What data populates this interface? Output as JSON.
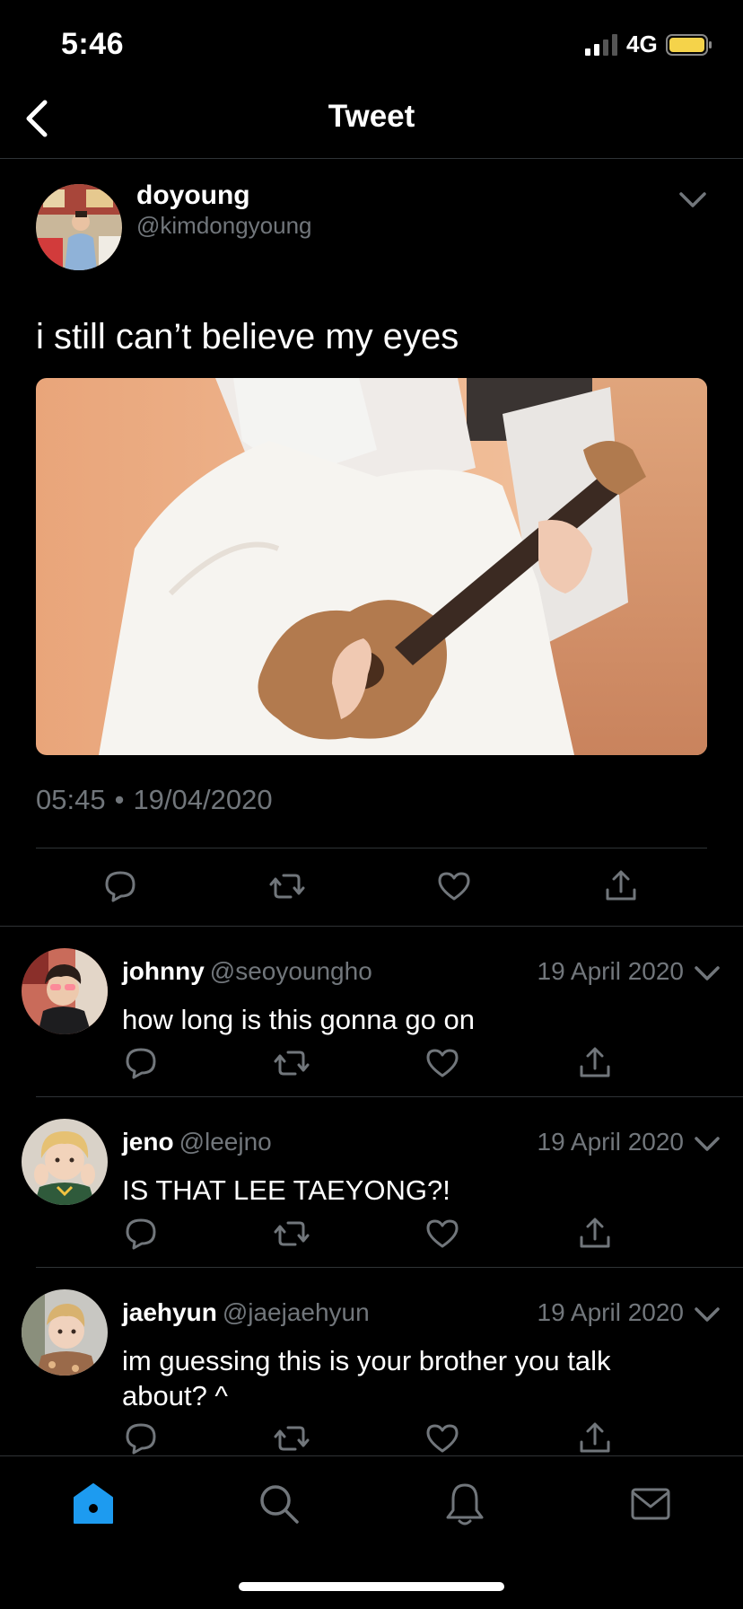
{
  "status_bar": {
    "time": "5:46",
    "network": "4G"
  },
  "header": {
    "title": "Tweet"
  },
  "main_tweet": {
    "display_name": "doyoung",
    "handle": "@kimdongyoung",
    "text": "i still can’t believe my eyes",
    "time": "05:45",
    "separator": "•",
    "date": "19/04/2020"
  },
  "replies": [
    {
      "display_name": "johnny",
      "handle": "@seoyoungho",
      "date": "19 April 2020",
      "text": "how long is this gonna go on"
    },
    {
      "display_name": "jeno",
      "handle": "@leejno",
      "date": "19 April 2020",
      "text": "IS THAT LEE TAEYONG?!"
    },
    {
      "display_name": "jaehyun",
      "handle": "@jaejaehyun",
      "date": "19 April 2020",
      "text": "im guessing this is your brother you talk about? ^"
    }
  ],
  "tab_bar": {
    "tabs": [
      "home-icon",
      "search-icon",
      "bell-icon",
      "mail-icon"
    ],
    "active": "home-icon"
  },
  "colors": {
    "background": "#000000",
    "text": "#ffffff",
    "secondary_text": "#71767b",
    "divider": "#2f3336",
    "accent": "#1d9bf0",
    "battery": "#f5d34a"
  }
}
